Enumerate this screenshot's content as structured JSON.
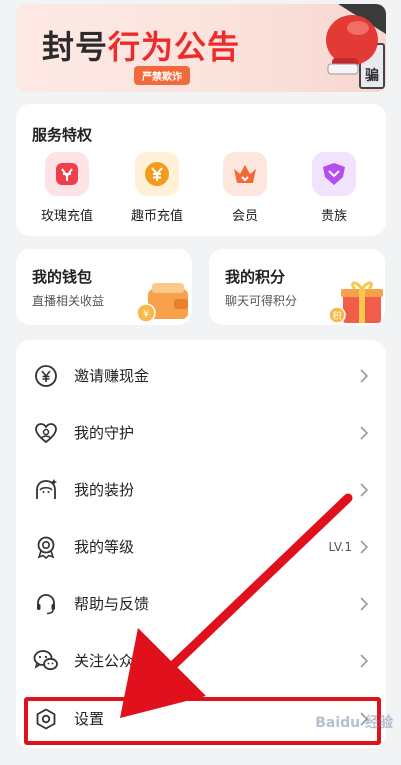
{
  "banner": {
    "title_dark": "封号",
    "title_red": "行为公告",
    "badge": "严禁欺诈",
    "stamp_char": "骗"
  },
  "services": {
    "title": "服务特权",
    "items": [
      {
        "label": "玫瑰充值",
        "icon": "rose-icon",
        "color": "#ef3e4c"
      },
      {
        "label": "趣币充值",
        "icon": "coin-icon",
        "color": "#f39b1a"
      },
      {
        "label": "会员",
        "icon": "crown-icon",
        "color": "#f06a3a"
      },
      {
        "label": "贵族",
        "icon": "noble-shield-icon",
        "color": "#b54df0"
      }
    ]
  },
  "wallet": {
    "title": "我的钱包",
    "subtitle": "直播相关收益",
    "icon": "wallet-icon"
  },
  "points": {
    "title": "我的积分",
    "subtitle": "聊天可得积分",
    "icon": "gift-box-icon"
  },
  "menu": {
    "items": [
      {
        "label": "邀请赚现金",
        "icon": "yuan-icon",
        "extra": ""
      },
      {
        "label": "我的守护",
        "icon": "heart-guard-icon",
        "extra": ""
      },
      {
        "label": "我的装扮",
        "icon": "dress-up-icon",
        "extra": ""
      },
      {
        "label": "我的等级",
        "icon": "level-medal-icon",
        "extra": "LV.1"
      },
      {
        "label": "帮助与反馈",
        "icon": "headset-icon",
        "extra": ""
      },
      {
        "label": "关注公众号",
        "icon": "wechat-icon",
        "extra": ""
      },
      {
        "label": "设置",
        "icon": "settings-icon",
        "extra": ""
      }
    ]
  },
  "watermark": "Baidu 经验",
  "colors": {
    "accent_red": "#e0101c",
    "banner_red": "#ee2b2b"
  }
}
